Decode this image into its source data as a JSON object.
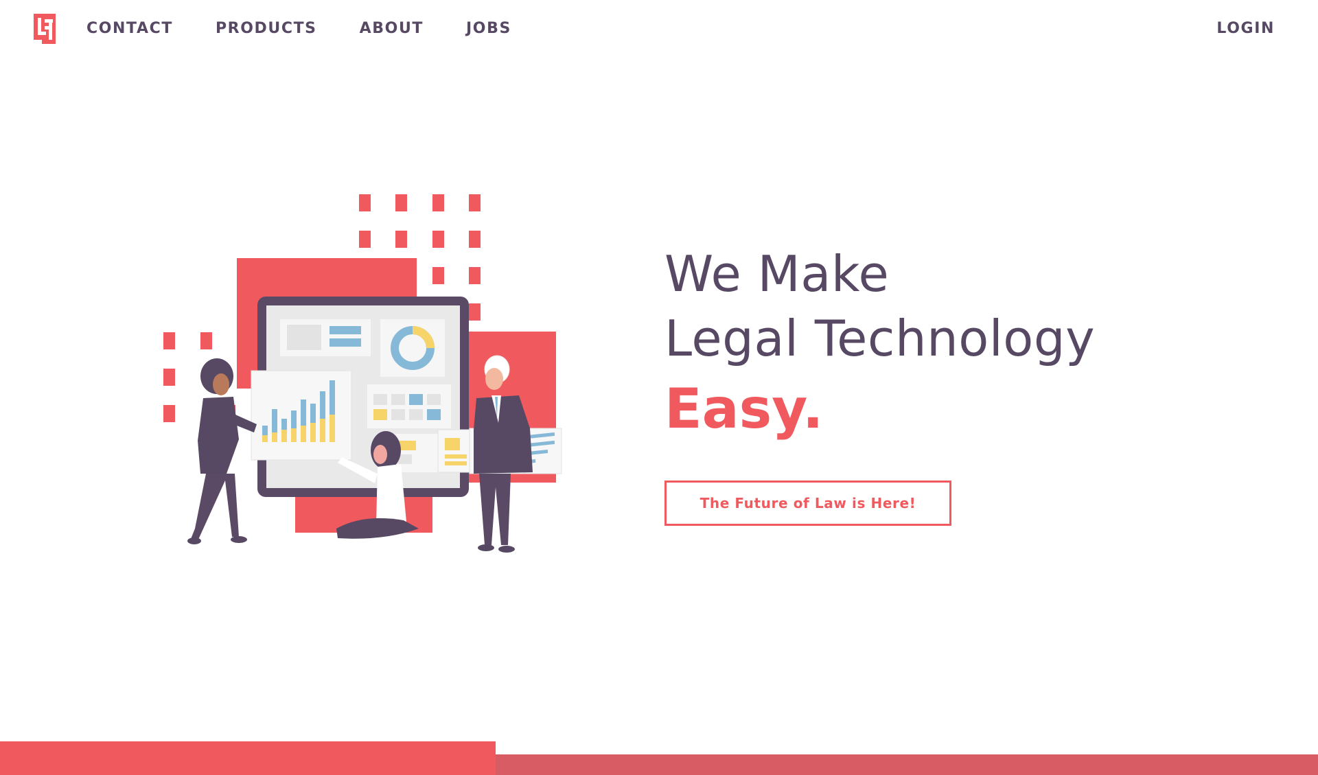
{
  "nav": {
    "links": [
      {
        "label": "CONTACT"
      },
      {
        "label": "PRODUCTS"
      },
      {
        "label": "ABOUT"
      },
      {
        "label": "JOBS"
      }
    ],
    "login_label": "LOGIN"
  },
  "hero": {
    "line1": "We Make",
    "line2": "Legal Technology",
    "accent": "Easy.",
    "cta_label": "The Future of Law is Here!"
  },
  "icons": {
    "logo": "brand-logo-icon"
  },
  "colors": {
    "brand_red": "#f05a5e",
    "brand_red_dark": "#d85c63",
    "text_purple": "#574964",
    "chart_blue": "#86b8d8",
    "chart_yellow": "#f6d46a",
    "panel_gray": "#ececec"
  }
}
